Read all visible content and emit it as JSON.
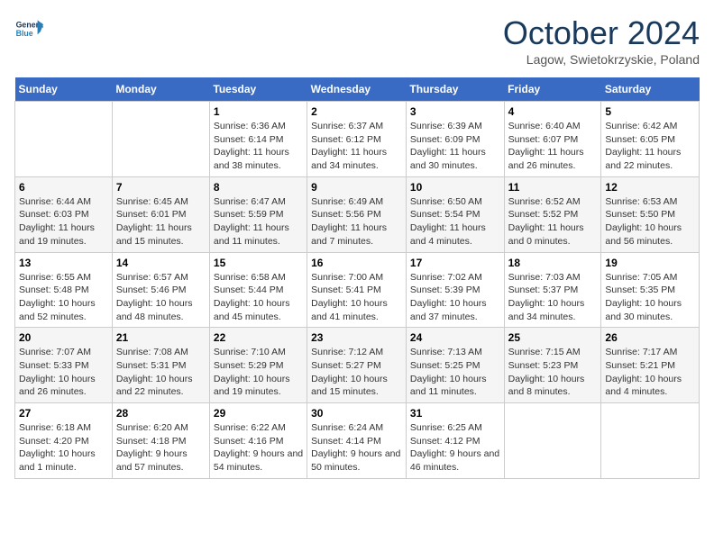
{
  "header": {
    "logo_general": "General",
    "logo_blue": "Blue",
    "title": "October 2024",
    "location": "Lagow, Swietokrzyskie, Poland"
  },
  "days_of_week": [
    "Sunday",
    "Monday",
    "Tuesday",
    "Wednesday",
    "Thursday",
    "Friday",
    "Saturday"
  ],
  "weeks": [
    [
      {
        "day": "",
        "text": ""
      },
      {
        "day": "",
        "text": ""
      },
      {
        "day": "1",
        "text": "Sunrise: 6:36 AM\nSunset: 6:14 PM\nDaylight: 11 hours and 38 minutes."
      },
      {
        "day": "2",
        "text": "Sunrise: 6:37 AM\nSunset: 6:12 PM\nDaylight: 11 hours and 34 minutes."
      },
      {
        "day": "3",
        "text": "Sunrise: 6:39 AM\nSunset: 6:09 PM\nDaylight: 11 hours and 30 minutes."
      },
      {
        "day": "4",
        "text": "Sunrise: 6:40 AM\nSunset: 6:07 PM\nDaylight: 11 hours and 26 minutes."
      },
      {
        "day": "5",
        "text": "Sunrise: 6:42 AM\nSunset: 6:05 PM\nDaylight: 11 hours and 22 minutes."
      }
    ],
    [
      {
        "day": "6",
        "text": "Sunrise: 6:44 AM\nSunset: 6:03 PM\nDaylight: 11 hours and 19 minutes."
      },
      {
        "day": "7",
        "text": "Sunrise: 6:45 AM\nSunset: 6:01 PM\nDaylight: 11 hours and 15 minutes."
      },
      {
        "day": "8",
        "text": "Sunrise: 6:47 AM\nSunset: 5:59 PM\nDaylight: 11 hours and 11 minutes."
      },
      {
        "day": "9",
        "text": "Sunrise: 6:49 AM\nSunset: 5:56 PM\nDaylight: 11 hours and 7 minutes."
      },
      {
        "day": "10",
        "text": "Sunrise: 6:50 AM\nSunset: 5:54 PM\nDaylight: 11 hours and 4 minutes."
      },
      {
        "day": "11",
        "text": "Sunrise: 6:52 AM\nSunset: 5:52 PM\nDaylight: 11 hours and 0 minutes."
      },
      {
        "day": "12",
        "text": "Sunrise: 6:53 AM\nSunset: 5:50 PM\nDaylight: 10 hours and 56 minutes."
      }
    ],
    [
      {
        "day": "13",
        "text": "Sunrise: 6:55 AM\nSunset: 5:48 PM\nDaylight: 10 hours and 52 minutes."
      },
      {
        "day": "14",
        "text": "Sunrise: 6:57 AM\nSunset: 5:46 PM\nDaylight: 10 hours and 48 minutes."
      },
      {
        "day": "15",
        "text": "Sunrise: 6:58 AM\nSunset: 5:44 PM\nDaylight: 10 hours and 45 minutes."
      },
      {
        "day": "16",
        "text": "Sunrise: 7:00 AM\nSunset: 5:41 PM\nDaylight: 10 hours and 41 minutes."
      },
      {
        "day": "17",
        "text": "Sunrise: 7:02 AM\nSunset: 5:39 PM\nDaylight: 10 hours and 37 minutes."
      },
      {
        "day": "18",
        "text": "Sunrise: 7:03 AM\nSunset: 5:37 PM\nDaylight: 10 hours and 34 minutes."
      },
      {
        "day": "19",
        "text": "Sunrise: 7:05 AM\nSunset: 5:35 PM\nDaylight: 10 hours and 30 minutes."
      }
    ],
    [
      {
        "day": "20",
        "text": "Sunrise: 7:07 AM\nSunset: 5:33 PM\nDaylight: 10 hours and 26 minutes."
      },
      {
        "day": "21",
        "text": "Sunrise: 7:08 AM\nSunset: 5:31 PM\nDaylight: 10 hours and 22 minutes."
      },
      {
        "day": "22",
        "text": "Sunrise: 7:10 AM\nSunset: 5:29 PM\nDaylight: 10 hours and 19 minutes."
      },
      {
        "day": "23",
        "text": "Sunrise: 7:12 AM\nSunset: 5:27 PM\nDaylight: 10 hours and 15 minutes."
      },
      {
        "day": "24",
        "text": "Sunrise: 7:13 AM\nSunset: 5:25 PM\nDaylight: 10 hours and 11 minutes."
      },
      {
        "day": "25",
        "text": "Sunrise: 7:15 AM\nSunset: 5:23 PM\nDaylight: 10 hours and 8 minutes."
      },
      {
        "day": "26",
        "text": "Sunrise: 7:17 AM\nSunset: 5:21 PM\nDaylight: 10 hours and 4 minutes."
      }
    ],
    [
      {
        "day": "27",
        "text": "Sunrise: 6:18 AM\nSunset: 4:20 PM\nDaylight: 10 hours and 1 minute."
      },
      {
        "day": "28",
        "text": "Sunrise: 6:20 AM\nSunset: 4:18 PM\nDaylight: 9 hours and 57 minutes."
      },
      {
        "day": "29",
        "text": "Sunrise: 6:22 AM\nSunset: 4:16 PM\nDaylight: 9 hours and 54 minutes."
      },
      {
        "day": "30",
        "text": "Sunrise: 6:24 AM\nSunset: 4:14 PM\nDaylight: 9 hours and 50 minutes."
      },
      {
        "day": "31",
        "text": "Sunrise: 6:25 AM\nSunset: 4:12 PM\nDaylight: 9 hours and 46 minutes."
      },
      {
        "day": "",
        "text": ""
      },
      {
        "day": "",
        "text": ""
      }
    ]
  ]
}
